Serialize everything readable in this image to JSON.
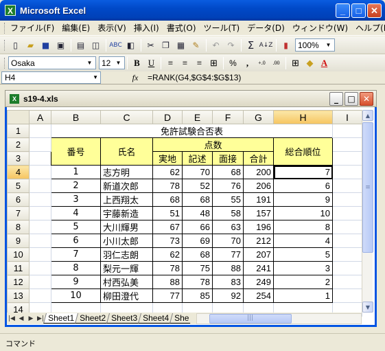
{
  "app": {
    "title": "Microsoft Excel",
    "icon_label": "X"
  },
  "window_buttons": {
    "minimize": "_",
    "maximize": "□",
    "close": "✕"
  },
  "menu": [
    "ファイル(F)",
    "編集(E)",
    "表示(V)",
    "挿入(I)",
    "書式(O)",
    "ツール(T)",
    "データ(D)",
    "ウィンドウ(W)",
    "ヘルプ(H)"
  ],
  "toolbar": {
    "zoom": "100%"
  },
  "format_toolbar": {
    "font_name": "Osaka",
    "font_size": "12",
    "bold": "B",
    "underline": "U",
    "percent": "%",
    "comma": ","
  },
  "formula_bar": {
    "name_box": "H4",
    "fx": "fx",
    "formula": "=RANK(G4,$G$4:$G$13)"
  },
  "workbook": {
    "title": "s19-4.xls",
    "icon_label": "X"
  },
  "columns": [
    "A",
    "B",
    "C",
    "D",
    "E",
    "F",
    "G",
    "H",
    "I"
  ],
  "rows": [
    "1",
    "2",
    "3",
    "4",
    "5",
    "6",
    "7",
    "8",
    "9",
    "10",
    "11",
    "12",
    "13",
    "14"
  ],
  "table": {
    "title": "免許試験合否表",
    "h_number": "番号",
    "h_name": "氏名",
    "h_score": "点数",
    "h_rank": "総合順位",
    "h_practical": "実地",
    "h_written": "記述",
    "h_interview": "面接",
    "h_total": "合計",
    "records": [
      {
        "no": "1",
        "name": "志方明",
        "practical": "62",
        "written": "70",
        "interview": "68",
        "total": "200",
        "rank": "7"
      },
      {
        "no": "2",
        "name": "新道次郎",
        "practical": "78",
        "written": "52",
        "interview": "76",
        "total": "206",
        "rank": "6"
      },
      {
        "no": "3",
        "name": "上西翔太",
        "practical": "68",
        "written": "68",
        "interview": "55",
        "total": "191",
        "rank": "9"
      },
      {
        "no": "4",
        "name": "宇藤新造",
        "practical": "51",
        "written": "48",
        "interview": "58",
        "total": "157",
        "rank": "10"
      },
      {
        "no": "5",
        "name": "大川輝男",
        "practical": "67",
        "written": "66",
        "interview": "63",
        "total": "196",
        "rank": "8"
      },
      {
        "no": "6",
        "name": "小川太郎",
        "practical": "73",
        "written": "69",
        "interview": "70",
        "total": "212",
        "rank": "4"
      },
      {
        "no": "7",
        "name": "羽仁志朗",
        "practical": "62",
        "written": "68",
        "interview": "77",
        "total": "207",
        "rank": "5"
      },
      {
        "no": "8",
        "name": "梨元一輝",
        "practical": "78",
        "written": "75",
        "interview": "88",
        "total": "241",
        "rank": "3"
      },
      {
        "no": "9",
        "name": "村西弘美",
        "practical": "88",
        "written": "78",
        "interview": "83",
        "total": "249",
        "rank": "2"
      },
      {
        "no": "10",
        "name": "柳田澄代",
        "practical": "77",
        "written": "85",
        "interview": "92",
        "total": "254",
        "rank": "1"
      }
    ]
  },
  "sheet_tabs": [
    "Sheet1",
    "Sheet2",
    "Sheet3",
    "Sheet4",
    "She"
  ],
  "status": "コマンド"
}
